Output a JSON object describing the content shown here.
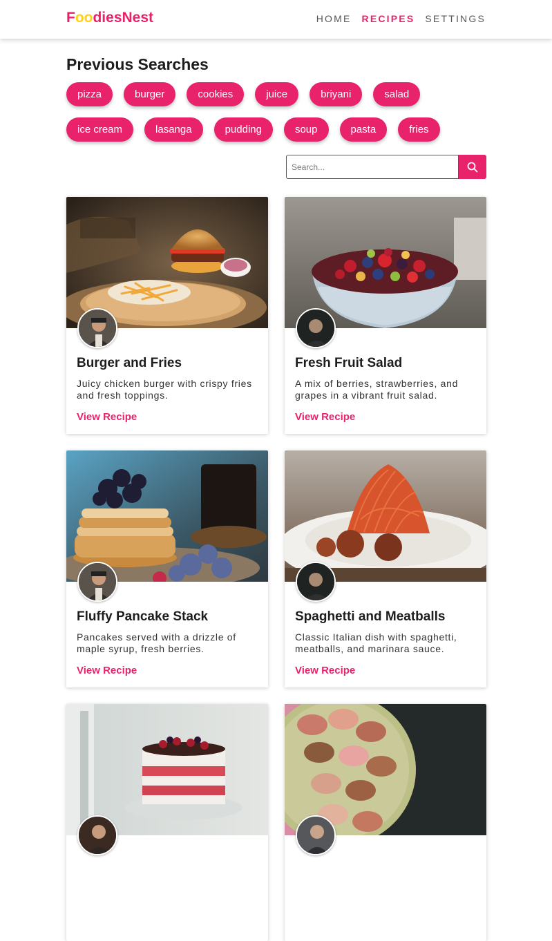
{
  "header": {
    "logo_parts": [
      "F",
      "oo",
      "diesNest"
    ],
    "nav": [
      {
        "label": "HOME",
        "active": false
      },
      {
        "label": "RECIPES",
        "active": true
      },
      {
        "label": "SETTINGS",
        "active": false
      }
    ]
  },
  "previous_searches": {
    "title": "Previous Searches",
    "row1": [
      "pizza",
      "burger",
      "cookies",
      "juice",
      "briyani",
      "salad"
    ],
    "row2": [
      "ice cream",
      "lasanga",
      "pudding",
      "soup",
      "pasta",
      "fries"
    ]
  },
  "search": {
    "placeholder": "Search..."
  },
  "recipes": [
    {
      "title": "Burger and Fries",
      "description": "Juicy chicken burger with crispy fries and fresh toppings.",
      "link": "View Recipe"
    },
    {
      "title": "Fresh Fruit Salad",
      "description": "A mix of berries, strawberries, and grapes in a vibrant fruit salad.",
      "link": "View Recipe"
    },
    {
      "title": "Fluffy Pancake Stack",
      "description": "Pancakes served with a drizzle of maple syrup, fresh berries.",
      "link": "View Recipe"
    },
    {
      "title": "Spaghetti and Meatballs",
      "description": "Classic Italian dish with spaghetti, meatballs, and marinara sauce.",
      "link": "View Recipe"
    },
    {
      "title": "",
      "description": "",
      "link": ""
    },
    {
      "title": "",
      "description": "",
      "link": ""
    }
  ],
  "colors": {
    "accent": "#e8226b",
    "logo_yellow": "#ffd11a"
  }
}
